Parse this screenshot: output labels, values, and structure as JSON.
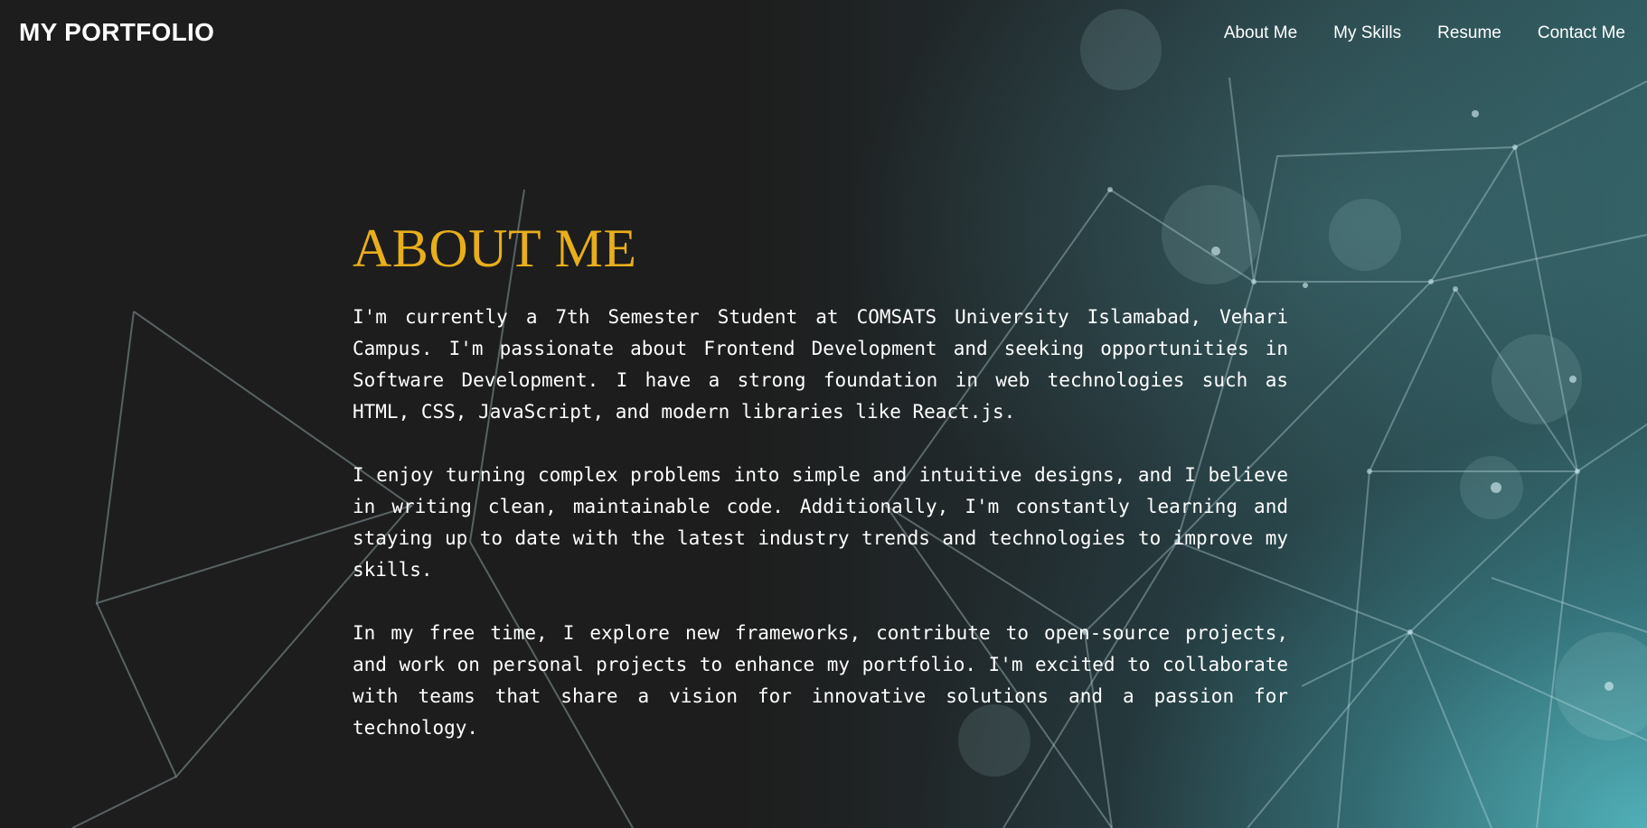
{
  "navbar": {
    "brand": "MY PORTFOLIO",
    "links": [
      "About Me",
      "My Skills",
      "Resume",
      "Contact Me"
    ]
  },
  "about": {
    "title": "ABOUT ME",
    "paragraphs": [
      "I'm currently a 7th Semester Student at COMSATS University Islamabad, Vehari Campus. I'm passionate about Frontend Development and seeking opportunities in Software Development. I have a strong foundation in web technologies such as HTML, CSS, JavaScript, and modern libraries like React.js.",
      "I enjoy turning complex problems into simple and intuitive designs, and I believe in writing clean, maintainable code. Additionally, I'm constantly learning and staying up to date with the latest industry trends and technologies to improve my skills.",
      "In my free time, I explore new frameworks, contribute to open-source projects, and work on personal projects to enhance my portfolio. I'm excited to collaborate with teams that share a vision for innovative solutions and a passion for technology."
    ]
  },
  "colors": {
    "accent": "#e8ae1b",
    "background": "#1c1c1c",
    "teal": "#56bec6"
  }
}
